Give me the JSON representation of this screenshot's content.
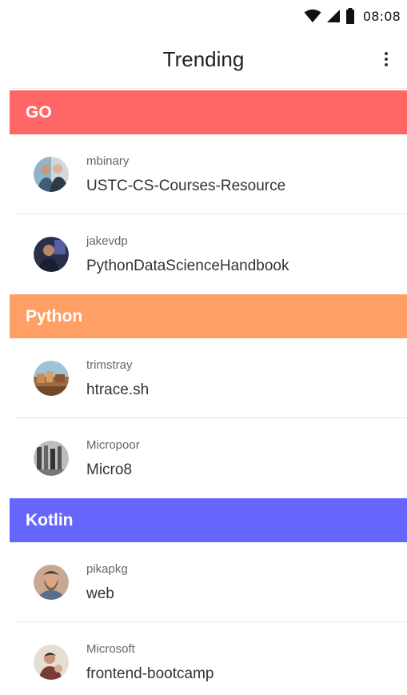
{
  "status_bar": {
    "time": "08:08",
    "icons": [
      "wifi-icon",
      "cellular-signal-icon",
      "battery-icon"
    ]
  },
  "app_bar": {
    "title": "Trending",
    "overflow_icon": "more-vert-icon"
  },
  "sections": [
    {
      "title": "GO",
      "color": "#ff6666",
      "repos": [
        {
          "owner": "mbinary",
          "name": "USTC-CS-Courses-Resource"
        },
        {
          "owner": "jakevdp",
          "name": "PythonDataScienceHandbook"
        }
      ]
    },
    {
      "title": "Python",
      "color": "#ff9f66",
      "repos": [
        {
          "owner": "trimstray",
          "name": "htrace.sh"
        },
        {
          "owner": "Micropoor",
          "name": "Micro8"
        }
      ]
    },
    {
      "title": "Kotlin",
      "color": "#6666ff",
      "repos": [
        {
          "owner": "pikapkg",
          "name": "web"
        },
        {
          "owner": "Microsoft",
          "name": "frontend-bootcamp"
        }
      ]
    }
  ],
  "next_section_color": "#b366ff"
}
